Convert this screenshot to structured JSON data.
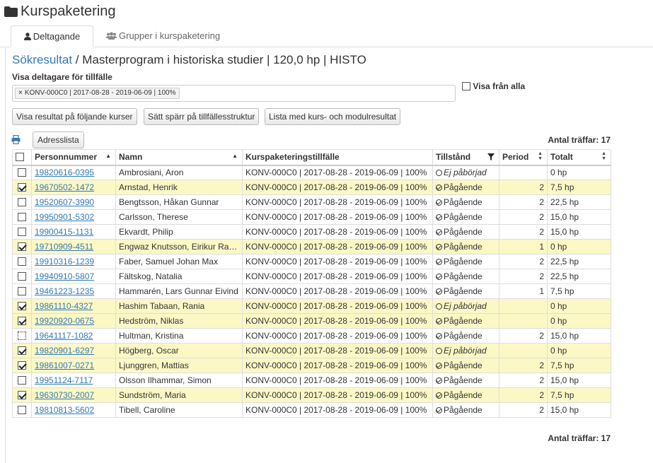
{
  "page": {
    "title": "Kurspaketering"
  },
  "tabs": [
    {
      "label": "Deltagande",
      "icon": "user-icon",
      "active": true
    },
    {
      "label": "Grupper i kurspaketering",
      "icon": "users-icon",
      "active": false
    }
  ],
  "breadcrumb": {
    "link": "Sökresultat",
    "separator": "/",
    "current": "Masterprogram i historiska studier | 120,0 hp | HISTO"
  },
  "filter": {
    "label": "Visa deltagare för tillfälle",
    "tag": "KONV-000C0 | 2017-08-28 - 2019-06-09 | 100%",
    "remove_symbol": "×",
    "show_all_label": "Visa från alla"
  },
  "buttons": {
    "show_results": "Visa resultat på följande kurser",
    "set_lock": "Sätt spärr på tillfällesstruktur",
    "results_list": "Lista med kurs- och modulresultat",
    "address_list": "Adresslista"
  },
  "hits": {
    "label": "Antal träffar: 17"
  },
  "table": {
    "columns": {
      "pnr": "Personnummer",
      "name": "Namn",
      "occasion": "Kurspaketeringstillfälle",
      "status": "Tillstånd",
      "period": "Period",
      "total": "Totalt"
    },
    "rows": [
      {
        "checked": false,
        "pnr": "19820616-0395",
        "name": "Ambrosiani, Aron",
        "occasion": "KONV-000C0 | 2017-08-28 - 2019-06-09 | 100%",
        "status": "Ej påbörjad",
        "status_type": "not-started",
        "period": "",
        "total": "0 hp"
      },
      {
        "checked": true,
        "pnr": "19670502-1472",
        "name": "Arnstad, Henrik",
        "occasion": "KONV-000C0 | 2017-08-28 - 2019-06-09 | 100%",
        "status": "Pågående",
        "status_type": "ongoing",
        "period": "2",
        "total": "7,5 hp"
      },
      {
        "checked": false,
        "pnr": "19520607-3990",
        "name": "Bengtsson, Håkan Gunnar",
        "occasion": "KONV-000C0 | 2017-08-28 - 2019-06-09 | 100%",
        "status": "Pågående",
        "status_type": "ongoing",
        "period": "2",
        "total": "22,5 hp"
      },
      {
        "checked": false,
        "pnr": "19950901-5302",
        "name": "Carlsson, Therese",
        "occasion": "KONV-000C0 | 2017-08-28 - 2019-06-09 | 100%",
        "status": "Pågående",
        "status_type": "ongoing",
        "period": "2",
        "total": "15,0 hp"
      },
      {
        "checked": false,
        "pnr": "19900415-1131",
        "name": "Ekvardt, Philip",
        "occasion": "KONV-000C0 | 2017-08-28 - 2019-06-09 | 100%",
        "status": "Pågående",
        "status_type": "ongoing",
        "period": "2",
        "total": "15,0 hp"
      },
      {
        "checked": true,
        "pnr": "19710909-4511",
        "name": "Engwaz Knutsson, Eirikur Ragnar",
        "occasion": "KONV-000C0 | 2017-08-28 - 2019-06-09 | 100%",
        "status": "Pågående",
        "status_type": "ongoing",
        "period": "1",
        "total": "0 hp"
      },
      {
        "checked": false,
        "pnr": "19910316-1239",
        "name": "Faber, Samuel Johan Max",
        "occasion": "KONV-000C0 | 2017-08-28 - 2019-06-09 | 100%",
        "status": "Pågående",
        "status_type": "ongoing",
        "period": "2",
        "total": "22,5 hp"
      },
      {
        "checked": false,
        "pnr": "19940910-5807",
        "name": "Fältskog, Natalia",
        "occasion": "KONV-000C0 | 2017-08-28 - 2019-06-09 | 100%",
        "status": "Pågående",
        "status_type": "ongoing",
        "period": "2",
        "total": "22,5 hp"
      },
      {
        "checked": false,
        "pnr": "19461223-1235",
        "name": "Hammarén, Lars Gunnar Eivind",
        "occasion": "KONV-000C0 | 2017-08-28 - 2019-06-09 | 100%",
        "status": "Pågående",
        "status_type": "ongoing",
        "period": "1",
        "total": "7,5 hp"
      },
      {
        "checked": true,
        "pnr": "19861110-4327",
        "name": "Hashim Tabaan, Rania",
        "occasion": "KONV-000C0 | 2017-08-28 - 2019-06-09 | 100%",
        "status": "Ej påbörjad",
        "status_type": "not-started",
        "period": "",
        "total": "0 hp"
      },
      {
        "checked": true,
        "pnr": "19920920-0675",
        "name": "Hedström, Niklas",
        "occasion": "KONV-000C0 | 2017-08-28 - 2019-06-09 | 100%",
        "status": "Pågående",
        "status_type": "ongoing",
        "period": "",
        "total": "0 hp"
      },
      {
        "checked": false,
        "focused": true,
        "pnr": "19641117-1082",
        "name": "Hultman, Kristina",
        "occasion": "KONV-000C0 | 2017-08-28 - 2019-06-09 | 100%",
        "status": "Pågående",
        "status_type": "ongoing",
        "period": "2",
        "total": "15,0 hp"
      },
      {
        "checked": true,
        "pnr": "19820901-6297",
        "name": "Högberg, Oscar",
        "occasion": "KONV-000C0 | 2017-08-28 - 2019-06-09 | 100%",
        "status": "Ej påbörjad",
        "status_type": "not-started",
        "period": "",
        "total": "0 hp"
      },
      {
        "checked": true,
        "pnr": "19861007-0271",
        "name": "Ljunggren, Mattias",
        "occasion": "KONV-000C0 | 2017-08-28 - 2019-06-09 | 100%",
        "status": "Pågående",
        "status_type": "ongoing",
        "period": "2",
        "total": "7,5 hp"
      },
      {
        "checked": false,
        "pnr": "19951124-7117",
        "name": "Olsson Ilhammar, Simon",
        "occasion": "KONV-000C0 | 2017-08-28 - 2019-06-09 | 100%",
        "status": "Pågående",
        "status_type": "ongoing",
        "period": "2",
        "total": "15,0 hp"
      },
      {
        "checked": true,
        "pnr": "19630730-2007",
        "name": "Sundström, Maria",
        "occasion": "KONV-000C0 | 2017-08-28 - 2019-06-09 | 100%",
        "status": "Pågående",
        "status_type": "ongoing",
        "period": "2",
        "total": "7,5 hp"
      },
      {
        "checked": false,
        "pnr": "19810813-5602",
        "name": "Tibell, Caroline",
        "occasion": "KONV-000C0 | 2017-08-28 - 2019-06-09 | 100%",
        "status": "Pågående",
        "status_type": "ongoing",
        "period": "2",
        "total": "15,0 hp"
      }
    ]
  },
  "colors": {
    "link": "#337ab7",
    "selected_row": "#fcf8c6",
    "border": "#dddddd"
  }
}
